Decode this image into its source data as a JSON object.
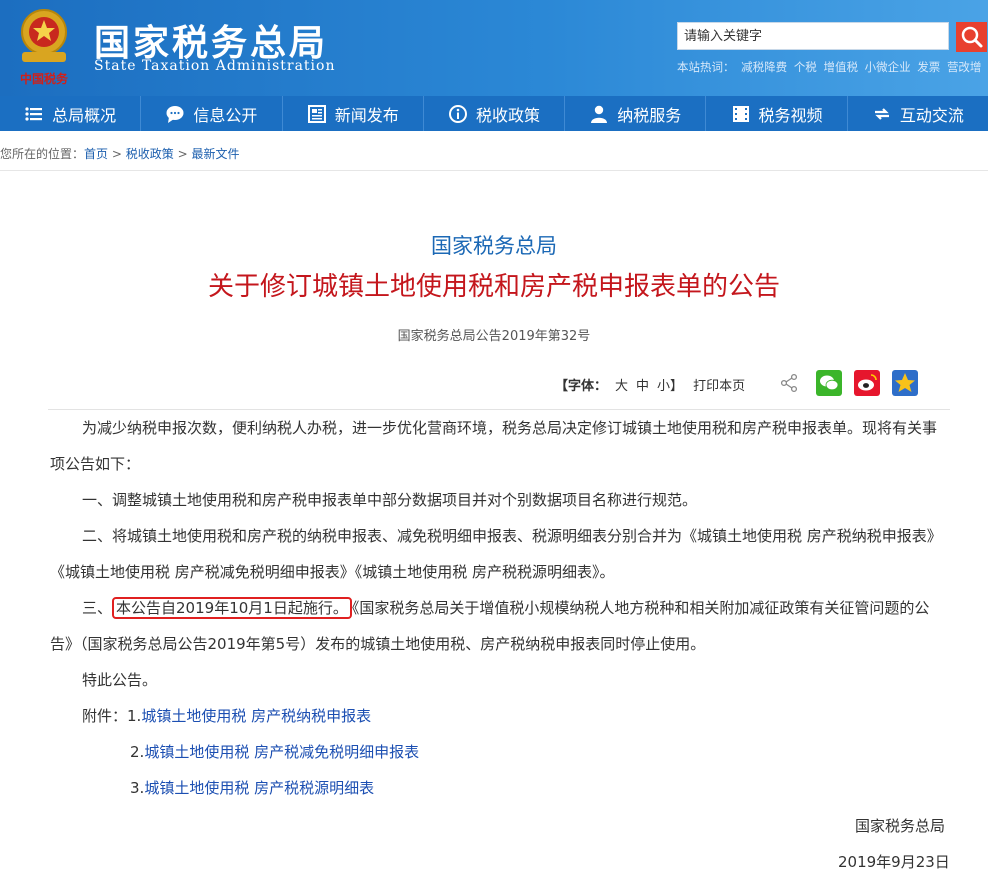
{
  "header": {
    "title_cn": "国家税务总局",
    "title_en": "State Taxation Administration",
    "logo_text": "中国税务",
    "search_placeholder": "请输入关键字",
    "hot_label": "本站热词：",
    "hot_words": [
      "减税降费",
      "个税",
      "增值税",
      "小微企业",
      "发票",
      "营改增"
    ]
  },
  "nav": {
    "items": [
      {
        "label": "总局概况",
        "icon": "menu-icon"
      },
      {
        "label": "信息公开",
        "icon": "chat-icon"
      },
      {
        "label": "新闻发布",
        "icon": "news-icon"
      },
      {
        "label": "税收政策",
        "icon": "info-icon"
      },
      {
        "label": "纳税服务",
        "icon": "user-icon"
      },
      {
        "label": "税务视频",
        "icon": "video-icon"
      },
      {
        "label": "互动交流",
        "icon": "exchange-icon"
      }
    ]
  },
  "breadcrumb": {
    "prefix": "您所在的位置：",
    "items": [
      "首页",
      "税收政策",
      "最新文件"
    ],
    "separator": ">"
  },
  "article": {
    "org": "国家税务总局",
    "title": "关于修订城镇土地使用税和房产税申报表单的公告",
    "doc_number": "国家税务总局公告2019年第32号",
    "tools": {
      "font_label": "【字体：",
      "font_large": "大",
      "font_medium": "中",
      "font_small": "小】",
      "print": "打印本页"
    },
    "paragraphs": {
      "intro": "为减少纳税申报次数，便利纳税人办税，进一步优化营商环境，税务总局决定修订城镇土地使用税和房产税申报表单。现将有关事项公告如下：",
      "item1": "一、调整城镇土地使用税和房产税申报表单中部分数据项目并对个别数据项目名称进行规范。",
      "item2": "二、将城镇土地使用税和房产税的纳税申报表、减免税明细申报表、税源明细表分别合并为《城镇土地使用税 房产税纳税申报表》《城镇土地使用税 房产税减免税明细申报表》《城镇土地使用税 房产税税源明细表》。",
      "item3_prefix": "三、",
      "item3_highlight": "本公告自2019年10月1日起施行。",
      "item3_rest": "《国家税务总局关于增值税小规模纳税人地方税种和相关附加减征政策有关征管问题的公告》（国家税务总局公告2019年第5号）发布的城镇土地使用税、房产税纳税申报表同时停止使用。",
      "closing": "特此公告。"
    },
    "attachments": {
      "label": "附件：",
      "items": [
        {
          "num": "1.",
          "text": "城镇土地使用税 房产税纳税申报表"
        },
        {
          "num": "2.",
          "text": "城镇土地使用税 房产税减免税明细申报表"
        },
        {
          "num": "3.",
          "text": "城镇土地使用税 房产税税源明细表"
        }
      ]
    },
    "signature": "国家税务总局",
    "date": "2019年9月23日"
  },
  "colors": {
    "nav_bg": "#1b6fc2",
    "title_red": "#c4161c",
    "org_blue": "#1b68b5",
    "link_blue": "#1c4fb2",
    "highlight_border": "#e02020"
  }
}
